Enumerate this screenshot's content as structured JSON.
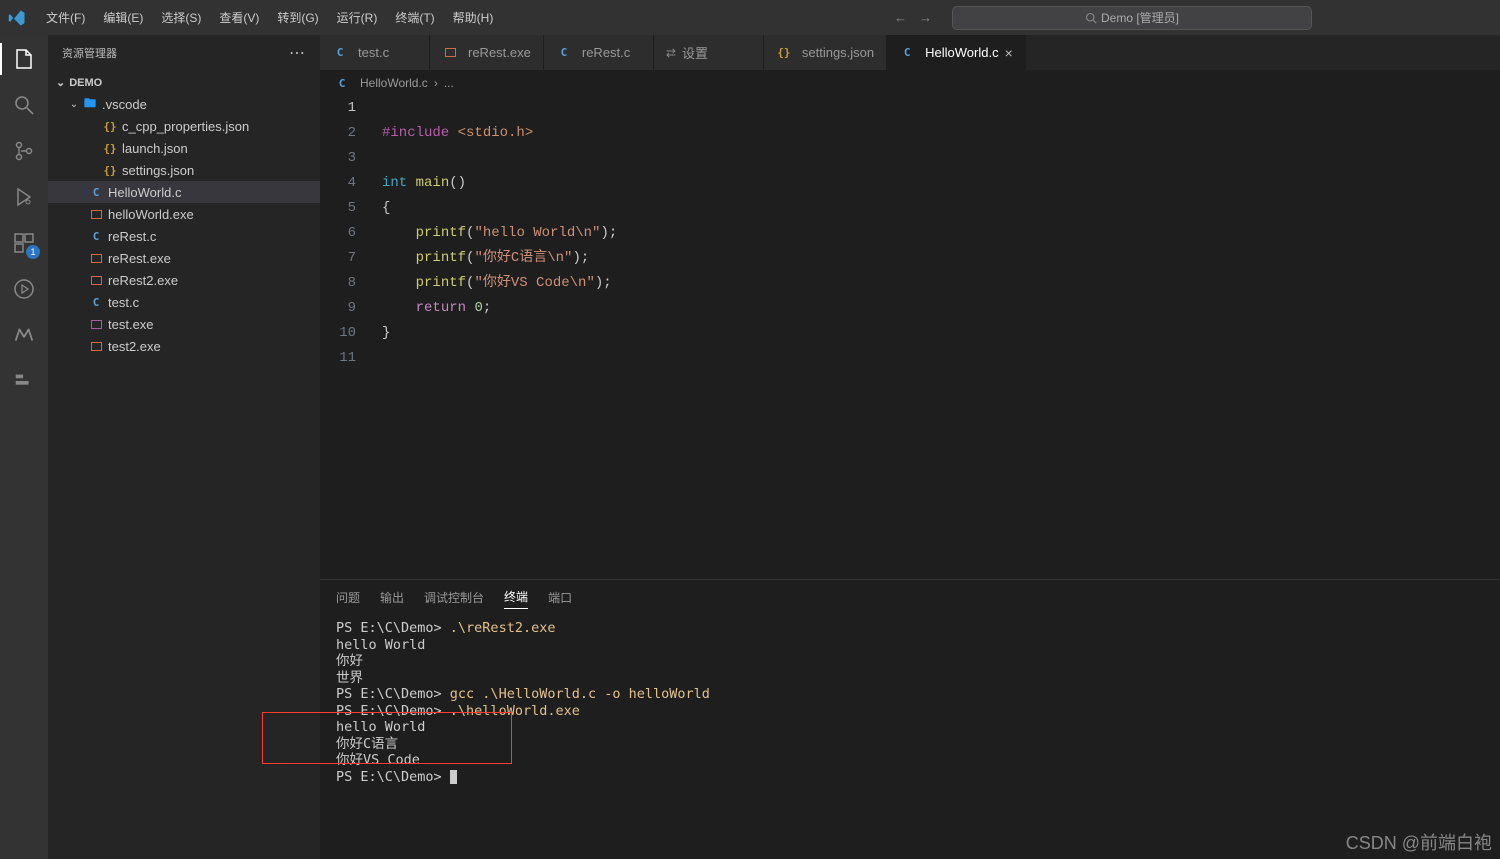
{
  "title_search": "Demo [管理员]",
  "menu": [
    "文件(F)",
    "编辑(E)",
    "选择(S)",
    "查看(V)",
    "转到(G)",
    "运行(R)",
    "终端(T)",
    "帮助(H)"
  ],
  "activity": {
    "badge_extensions": "1"
  },
  "sidebar": {
    "title": "资源管理器",
    "root": "DEMO",
    "folder": ".vscode",
    "files": [
      {
        "name": "c_cpp_properties.json",
        "icon": "json",
        "indent": 3
      },
      {
        "name": "launch.json",
        "icon": "json",
        "indent": 3
      },
      {
        "name": "settings.json",
        "icon": "json",
        "indent": 3
      },
      {
        "name": "HelloWorld.c",
        "icon": "c",
        "indent": 2,
        "selected": true
      },
      {
        "name": "helloWorld.exe",
        "icon": "exe",
        "indent": 2
      },
      {
        "name": "reRest.c",
        "icon": "c",
        "indent": 2
      },
      {
        "name": "reRest.exe",
        "icon": "exe",
        "indent": 2
      },
      {
        "name": "reRest2.exe",
        "icon": "exe",
        "indent": 2
      },
      {
        "name": "test.c",
        "icon": "c",
        "indent": 2
      },
      {
        "name": "test.exe",
        "icon": "exep",
        "indent": 2
      },
      {
        "name": "test2.exe",
        "icon": "exe",
        "indent": 2
      }
    ]
  },
  "tabs": [
    {
      "label": "test.c",
      "icon": "c"
    },
    {
      "label": "reRest.exe",
      "icon": "exe"
    },
    {
      "label": "reRest.c",
      "icon": "c"
    },
    {
      "label": "设置",
      "icon": "settings"
    },
    {
      "label": "settings.json",
      "icon": "json"
    },
    {
      "label": "HelloWorld.c",
      "icon": "c",
      "active": true,
      "close": "×"
    }
  ],
  "breadcrumb": {
    "file": "HelloWorld.c",
    "sep": "›",
    "more": "..."
  },
  "code": {
    "line_count": 11,
    "current_line": 1,
    "lines": [
      "",
      "#include <stdio.h>",
      "",
      "int main()",
      "{",
      "    printf(\"hello World\\n\");",
      "    printf(\"你好C语言\\n\");",
      "    printf(\"你好VS Code\\n\");",
      "    return 0;",
      "}",
      ""
    ]
  },
  "panel": {
    "tabs": [
      "问题",
      "输出",
      "调试控制台",
      "终端",
      "端口"
    ],
    "active": 3,
    "terminal": [
      {
        "prompt": "PS E:\\C\\Demo> ",
        "cmd": ".\\reRest2.exe"
      },
      {
        "text": "hello World"
      },
      {
        "text": "你好"
      },
      {
        "text": "世界"
      },
      {
        "prompt": "PS E:\\C\\Demo> ",
        "cmd": "gcc .\\HelloWorld.c -o helloWorld"
      },
      {
        "prompt": "PS E:\\C\\Demo> ",
        "cmd": ".\\helloWorld.exe"
      },
      {
        "text": "hello World"
      },
      {
        "text": "你好C语言"
      },
      {
        "text": "你好VS Code"
      },
      {
        "prompt": "PS E:\\C\\Demo> ",
        "cursor": true
      }
    ]
  },
  "watermark": "CSDN @前端白袍"
}
